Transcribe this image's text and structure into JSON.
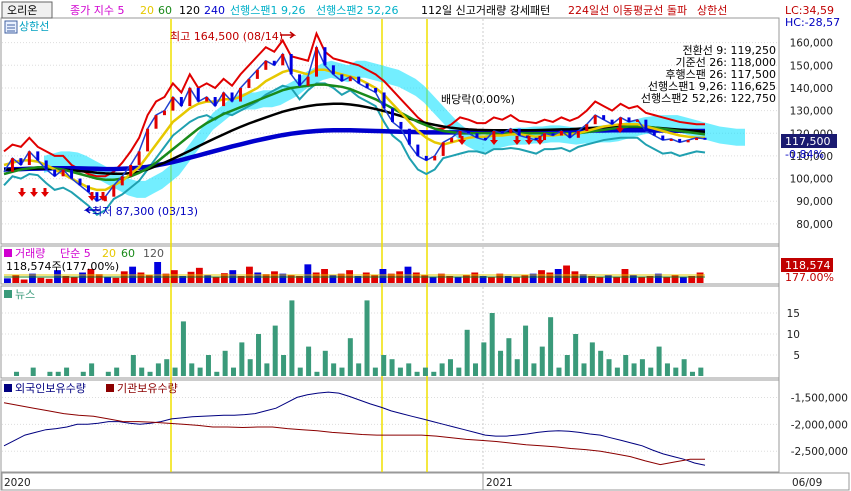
{
  "header": {
    "stock_button": "오리온",
    "legend_items": [
      {
        "text": "종가 지수 5",
        "color": "#d000d0"
      },
      {
        "text": "20",
        "color": "#e6c800"
      },
      {
        "text": "60",
        "color": "#1a8a1a"
      },
      {
        "text": "120",
        "color": "#000000"
      },
      {
        "text": "240",
        "color": "#0000cc"
      },
      {
        "text": "선행스팬1 9,26",
        "color": "#00b0c8"
      },
      {
        "text": "선행스팬2 52,26",
        "color": "#00b0c8"
      },
      {
        "text": "112일 신고거래량 강세패턴",
        "color": "#000000"
      },
      {
        "text": "224일선 이동평균선 돌파",
        "color": "#c00000"
      },
      {
        "text": "상한선",
        "color": "#c00000"
      }
    ],
    "second_line": "상한선",
    "lc": "LC:34,59",
    "hc": "HC:-28,57"
  },
  "price_panel": {
    "ichimoku_labels": [
      {
        "text": "전환선 9: 119,250",
        "color": "#00a000"
      },
      {
        "text": "기준선 26: 118,000",
        "color": "#555555"
      },
      {
        "text": "후행스팬 26: 117,500",
        "color": "#b000b0"
      },
      {
        "text": "선행스팬1 9,26: 116,625",
        "color": "#00a0c0"
      },
      {
        "text": "선행스팬2 52,26: 122,750",
        "color": "#00a0c0"
      }
    ],
    "high_annotation": "최고 164,500 (08/14)",
    "low_annotation": "최저 87,300 (03/13)",
    "dividend_label": "배당락(0.00%)",
    "current_price": "117,500",
    "change_pct": "-0.84%"
  },
  "volume_panel": {
    "legend_items": [
      {
        "text": "거래량",
        "color": "#d000d0"
      },
      {
        "text": "단순 5",
        "color": "#d000d0"
      },
      {
        "text": "20",
        "color": "#e6c800"
      },
      {
        "text": "60",
        "color": "#1a8a1a"
      },
      {
        "text": "120",
        "color": "#555555"
      }
    ],
    "volume_text": "118,574주(177.00%)",
    "current_volume": "118,574",
    "volume_pct": "177.00%"
  },
  "news_panel": {
    "title": "뉴스"
  },
  "holdings_panel": {
    "legend_items": [
      {
        "text": "외국인보유수량",
        "color": "#000080"
      },
      {
        "text": "기관보유수량",
        "color": "#8b0000"
      }
    ]
  },
  "x_axis": {
    "labels": [
      "2020",
      "2021",
      "06/09"
    ]
  },
  "chart_data": [
    {
      "type": "line",
      "name": "price",
      "ylim": [
        72000,
        170000
      ],
      "ytick_labels": [
        "80,000",
        "90,000",
        "100,000",
        "110,000",
        "120,000",
        "130,000",
        "140,000",
        "150,000",
        "160,000"
      ],
      "yticks": [
        80000,
        90000,
        100000,
        110000,
        120000,
        130000,
        140000,
        150000,
        160000
      ],
      "series": [
        {
          "name": "종가",
          "color": "#2040d0",
          "values": [
            103000,
            109000,
            106000,
            112000,
            108000,
            104000,
            101000,
            104000,
            100000,
            97000,
            94000,
            90000,
            92000,
            97000,
            101000,
            106000,
            112000,
            122000,
            128000,
            130000,
            136000,
            132000,
            140000,
            134000,
            136000,
            132000,
            138000,
            134000,
            140000,
            144000,
            148000,
            152000,
            150000,
            155000,
            146000,
            141000,
            145000,
            158000,
            150000,
            146000,
            143000,
            145000,
            142000,
            140000,
            138000,
            131000,
            125000,
            122000,
            115000,
            110000,
            108000,
            110000,
            116000,
            118000,
            121000,
            120000,
            118000,
            117000,
            121000,
            120000,
            122000,
            119000,
            118000,
            117000,
            120000,
            119000,
            121000,
            118000,
            121000,
            124000,
            128000,
            126000,
            124000,
            127000,
            125000,
            126000,
            121000,
            119000,
            117000,
            117500,
            116000,
            117000,
            118000,
            117500
          ]
        },
        {
          "name": "20",
          "color": "#e6c800",
          "values": [
            106000,
            107000,
            108000,
            108000,
            107500,
            106000,
            104000,
            102000,
            100000,
            98000,
            96000,
            95000,
            95000,
            97000,
            99000,
            102000,
            105000,
            110000,
            115000,
            120000,
            125000,
            128000,
            131000,
            133000,
            134000,
            134000,
            135000,
            135000,
            136000,
            138000,
            140000,
            143000,
            145000,
            147000,
            148000,
            147000,
            146000,
            148000,
            148000,
            147000,
            146000,
            145000,
            144000,
            142000,
            140000,
            137000,
            133000,
            129000,
            125000,
            121000,
            118000,
            116000,
            115000,
            116000,
            117000,
            118000,
            118500,
            118500,
            119000,
            119000,
            119500,
            119500,
            119000,
            118500,
            119000,
            119000,
            119500,
            119500,
            120000,
            121000,
            122000,
            123000,
            123500,
            124000,
            124000,
            124000,
            123000,
            122000,
            121000,
            120000,
            119000,
            118500,
            118000,
            118000
          ]
        },
        {
          "name": "60",
          "color": "#1a8a1a",
          "values": [
            102000,
            103000,
            104000,
            104500,
            105000,
            105000,
            104500,
            104000,
            103000,
            102000,
            101000,
            100000,
            99500,
            99500,
            100000,
            101000,
            102500,
            104500,
            107000,
            110000,
            113000,
            116000,
            119000,
            122000,
            124500,
            126500,
            128500,
            130000,
            131500,
            133000,
            134500,
            136000,
            137500,
            139000,
            140000,
            140500,
            141000,
            141500,
            141500,
            141000,
            140500,
            139500,
            138000,
            136500,
            135000,
            133000,
            131000,
            129000,
            127000,
            125000,
            123500,
            122000,
            121000,
            120500,
            120000,
            120000,
            120000,
            120000,
            120000,
            120000,
            120000,
            120000,
            120000,
            120000,
            120000,
            120000,
            120000,
            120000,
            120000,
            120500,
            121000,
            121500,
            122000,
            122500,
            123000,
            123000,
            123000,
            122500,
            122000,
            121500,
            121000,
            120500,
            120000,
            119500
          ]
        },
        {
          "name": "120",
          "color": "#000000",
          "values": [
            104000,
            104000,
            104200,
            104300,
            104400,
            104400,
            104300,
            104000,
            103700,
            103300,
            103000,
            102600,
            102300,
            102100,
            102100,
            102400,
            103000,
            104000,
            105500,
            107000,
            108700,
            110500,
            112300,
            114200,
            116000,
            117800,
            119500,
            121200,
            122800,
            124300,
            125700,
            127000,
            128300,
            129500,
            130500,
            131300,
            132000,
            132500,
            132800,
            133000,
            133000,
            132700,
            132200,
            131500,
            130700,
            129800,
            128700,
            127600,
            126500,
            125400,
            124500,
            123700,
            123000,
            122400,
            122000,
            121700,
            121500,
            121400,
            121300,
            121300,
            121300,
            121300,
            121300,
            121400,
            121500,
            121600,
            121700,
            121800,
            122000,
            122200,
            122400,
            122600,
            122700,
            122800,
            122800,
            122800,
            122700,
            122500,
            122200,
            121900,
            121600,
            121300,
            121000,
            120700
          ]
        },
        {
          "name": "240",
          "color": "#0000cc",
          "values": [
            104000,
            104100,
            104200,
            104300,
            104400,
            104500,
            104600,
            104600,
            104600,
            104500,
            104400,
            104300,
            104200,
            104200,
            104300,
            104500,
            104800,
            105200,
            105800,
            106500,
            107300,
            108200,
            109200,
            110200,
            111200,
            112200,
            113200,
            114200,
            115100,
            116000,
            116900,
            117700,
            118500,
            119200,
            119800,
            120300,
            120700,
            121000,
            121200,
            121300,
            121300,
            121300,
            121200,
            121100,
            121000,
            120900,
            120800,
            120700,
            120600,
            120500,
            120400,
            120400,
            120400,
            120400,
            120400,
            120400,
            120500,
            120500,
            120600,
            120600,
            120700,
            120700,
            120800,
            120800,
            120900,
            120900,
            121000,
            121000,
            121100,
            121100,
            121200,
            121200,
            121300,
            121300,
            121300,
            121300,
            121300,
            121200,
            121200,
            121100,
            121100,
            121000,
            121000,
            121000
          ]
        }
      ]
    },
    {
      "type": "bar",
      "name": "volume",
      "series": [
        {
          "name": "거래량",
          "values": [
            20,
            35,
            15,
            40,
            22,
            18,
            55,
            30,
            25,
            45,
            60,
            38,
            28,
            22,
            50,
            70,
            45,
            35,
            90,
            40,
            55,
            30,
            48,
            65,
            35,
            28,
            42,
            55,
            30,
            70,
            45,
            38,
            50,
            40,
            35,
            30,
            80,
            45,
            60,
            35,
            40,
            55,
            30,
            45,
            35,
            60,
            40,
            50,
            70,
            45,
            35,
            28,
            40,
            30,
            25,
            35,
            45,
            30,
            25,
            40,
            30,
            28,
            35,
            40,
            55,
            45,
            60,
            75,
            50,
            38,
            30,
            25,
            35,
            28,
            60,
            35,
            25,
            30,
            40,
            28,
            35,
            25,
            30,
            45
          ]
        }
      ]
    },
    {
      "type": "bar",
      "name": "news",
      "yticks": [
        5,
        10,
        15
      ],
      "ytick_labels": [
        "5",
        "10",
        "15"
      ],
      "ylim": [
        0,
        20
      ],
      "series": [
        {
          "name": "뉴스",
          "values": [
            0,
            1,
            0,
            2,
            0,
            1,
            1,
            2,
            0,
            1,
            3,
            0,
            1,
            2,
            0,
            5,
            2,
            1,
            3,
            4,
            2,
            13,
            3,
            2,
            5,
            1,
            6,
            2,
            8,
            4,
            10,
            3,
            12,
            5,
            18,
            2,
            7,
            1,
            6,
            3,
            2,
            9,
            3,
            18,
            2,
            5,
            4,
            2,
            3,
            1,
            2,
            1,
            3,
            4,
            2,
            11,
            3,
            8,
            15,
            6,
            9,
            4,
            12,
            3,
            7,
            14,
            2,
            5,
            10,
            3,
            8,
            6,
            4,
            2,
            5,
            3,
            4,
            2,
            7,
            3,
            2,
            4,
            1,
            2
          ]
        }
      ]
    },
    {
      "type": "line",
      "name": "holdings",
      "ylim": [
        -2850000,
        -1250000
      ],
      "yticks": [
        -1500000,
        -2000000,
        -2500000
      ],
      "ytick_labels": [
        "-1,500,000",
        "-2,000,000",
        "-2,500,000"
      ],
      "series": [
        {
          "name": "외국인보유수량",
          "color": "#000080",
          "values": [
            -2400000,
            -2300000,
            -2200000,
            -2150000,
            -2100000,
            -2080000,
            -2050000,
            -2000000,
            -2000000,
            -1980000,
            -1950000,
            -1950000,
            -1980000,
            -2000000,
            -1980000,
            -1950000,
            -1900000,
            -1880000,
            -1860000,
            -1850000,
            -1840000,
            -1830000,
            -1830000,
            -1820000,
            -1800000,
            -1750000,
            -1700000,
            -1600000,
            -1500000,
            -1450000,
            -1420000,
            -1400000,
            -1420000,
            -1480000,
            -1550000,
            -1620000,
            -1680000,
            -1750000,
            -1800000,
            -1850000,
            -1900000,
            -1950000,
            -2000000,
            -2050000,
            -2100000,
            -2150000,
            -2200000,
            -2220000,
            -2220000,
            -2200000,
            -2180000,
            -2150000,
            -2130000,
            -2120000,
            -2130000,
            -2150000,
            -2180000,
            -2200000,
            -2250000,
            -2300000,
            -2350000,
            -2400000,
            -2480000,
            -2550000,
            -2600000,
            -2650000,
            -2720000,
            -2760000
          ]
        },
        {
          "name": "기관보유수량",
          "color": "#8b0000",
          "values": [
            -1600000,
            -1650000,
            -1700000,
            -1750000,
            -1800000,
            -1830000,
            -1850000,
            -1900000,
            -1950000,
            -1950000,
            -1960000,
            -1980000,
            -2000000,
            -2020000,
            -2050000,
            -2050000,
            -2060000,
            -2050000,
            -2050000,
            -2080000,
            -2100000,
            -2120000,
            -2150000,
            -2170000,
            -2190000,
            -2200000,
            -2200000,
            -2200000,
            -2200000,
            -2220000,
            -2250000,
            -2280000,
            -2300000,
            -2320000,
            -2350000,
            -2380000,
            -2400000,
            -2420000,
            -2450000,
            -2470000,
            -2500000,
            -2550000,
            -2600000,
            -2680000,
            -2750000,
            -2700000,
            -2650000,
            -2650000
          ]
        }
      ]
    }
  ]
}
